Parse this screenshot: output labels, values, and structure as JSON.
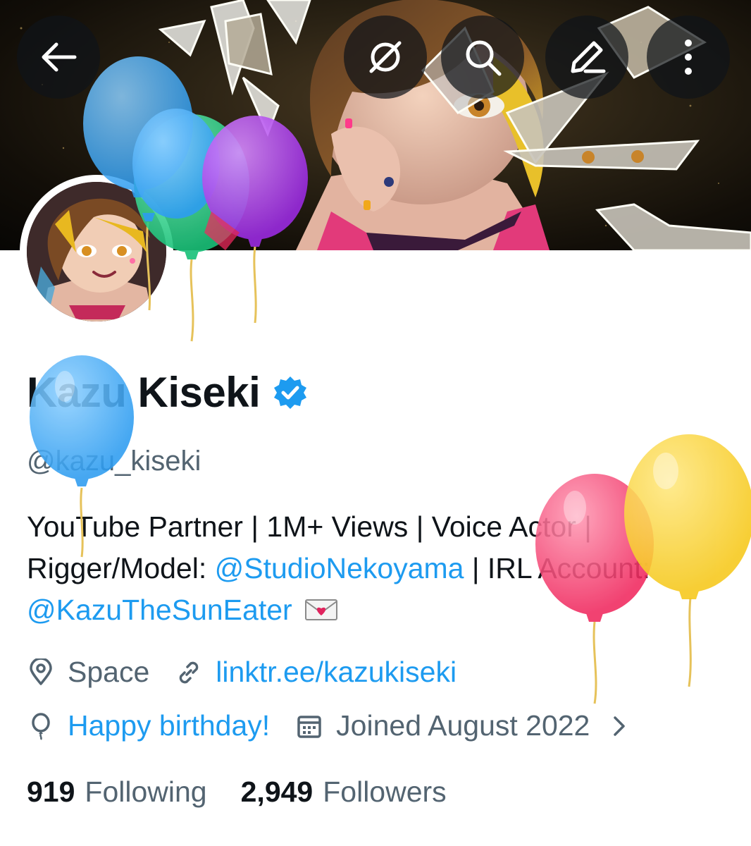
{
  "header": {
    "back_icon": "arrow-left-icon",
    "grok_icon": "grok-icon",
    "search_icon": "search-icon",
    "edit_icon": "edit-icon",
    "more_icon": "more-vertical-icon"
  },
  "profile": {
    "display_name": "Kazu Kiseki",
    "verified_color": "#1d9bf0",
    "handle": "@kazu_kiseki",
    "bio": {
      "line1": "YouTube Partner | 1M+ Views | Voice Actor |",
      "line2_prefix": "Rigger/Model: ",
      "line2_mention": "@StudioNekoyama",
      "line2_suffix": " | IRL Account:",
      "line3_mention": "@KazuTheSunEater"
    },
    "location": "Space",
    "website": "linktr.ee/kazukiseki",
    "birthday": "Happy birthday!",
    "joined": "Joined August 2022",
    "following_count": "919",
    "following_label": "Following",
    "followers_count": "2,949",
    "followers_label": "Followers"
  },
  "colors": {
    "link": "#1d9bf0",
    "secondary_text": "#536471",
    "primary_text": "#0f1419"
  }
}
